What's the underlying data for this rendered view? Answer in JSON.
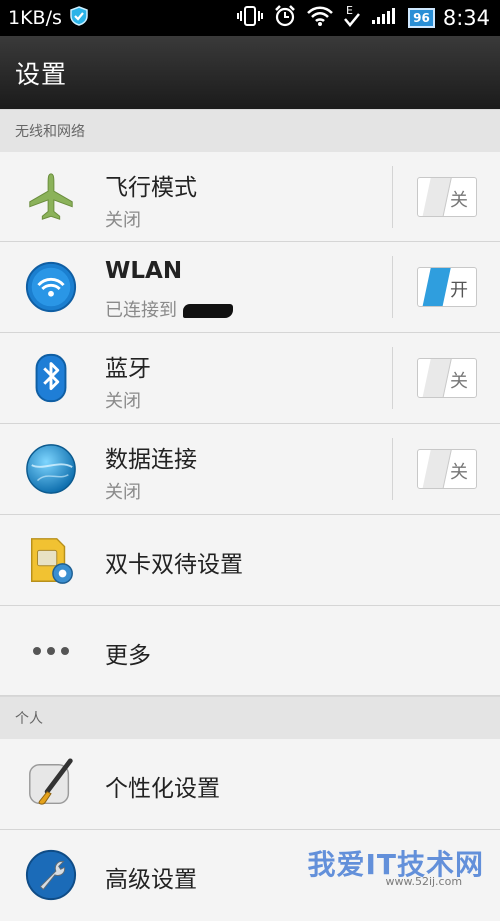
{
  "status_bar": {
    "network_speed": "1KB/s",
    "shield_icon": "shield-check-icon",
    "vibrate_icon": "vibrate-icon",
    "alarm_icon": "alarm-icon",
    "wifi_icon": "wifi-icon",
    "data_icon": "edge-data-icon",
    "signal_icon": "signal-icon",
    "battery_level": "96",
    "time": "8:34"
  },
  "title_bar": {
    "title": "设置"
  },
  "sections": {
    "wireless": "无线和网络",
    "personal": "个人"
  },
  "items": [
    {
      "name": "airplane",
      "label": "飞行模式",
      "sub": "关闭",
      "toggle": "关",
      "toggle_on": false,
      "icon": "airplane-icon"
    },
    {
      "name": "wlan",
      "label": "WLAN",
      "sub": "已连接到",
      "toggle": "开",
      "toggle_on": true,
      "icon": "wifi-globe-icon"
    },
    {
      "name": "bluetooth",
      "label": "蓝牙",
      "sub": "关闭",
      "toggle": "关",
      "toggle_on": false,
      "icon": "bluetooth-icon"
    },
    {
      "name": "mobile-data",
      "label": "数据连接",
      "sub": "关闭",
      "toggle": "关",
      "toggle_on": false,
      "icon": "globe-icon"
    },
    {
      "name": "dual-sim",
      "label": "双卡双待设置",
      "icon": "sim-card-gear-icon"
    },
    {
      "name": "more",
      "label": "更多",
      "icon": "more-dots-icon"
    },
    {
      "name": "personalize",
      "label": "个性化设置",
      "icon": "paintbrush-icon"
    },
    {
      "name": "advanced",
      "label": "高级设置",
      "icon": "wrench-icon"
    }
  ],
  "watermark": {
    "text": "我爱IT技术网",
    "url": "www.52ij.com"
  },
  "colors": {
    "accent": "#2f9ede",
    "titlebar": "#262626",
    "background": "#f4f4f4"
  }
}
